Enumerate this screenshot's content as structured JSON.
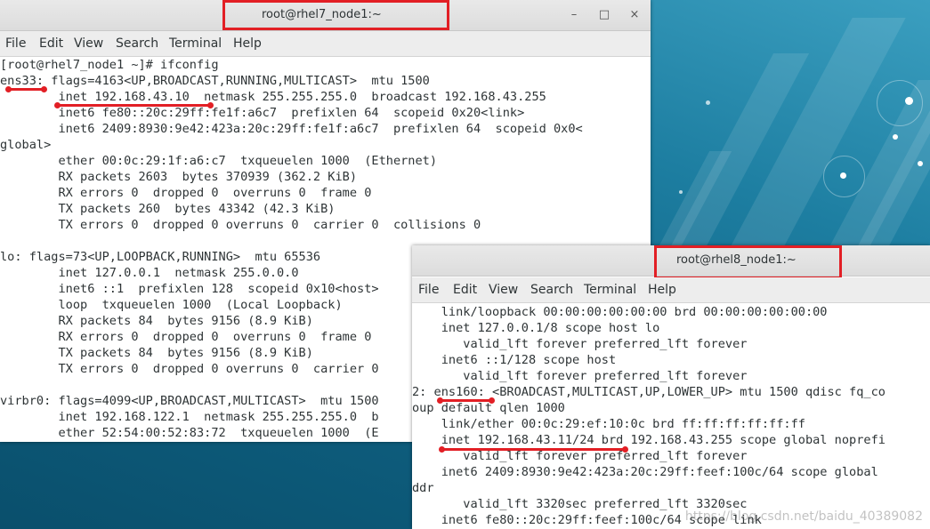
{
  "window1": {
    "title": "root@rhel7_node1:~",
    "menu": [
      "File",
      "Edit",
      "View",
      "Search",
      "Terminal",
      "Help"
    ],
    "controls": {
      "minimize": "–",
      "maximize": "□",
      "close": "×"
    },
    "lines": [
      "[root@rhel7_node1 ~]# ifconfig",
      "ens33: flags=4163<UP,BROADCAST,RUNNING,MULTICAST>  mtu 1500",
      "        inet 192.168.43.10  netmask 255.255.255.0  broadcast 192.168.43.255",
      "        inet6 fe80::20c:29ff:fe1f:a6c7  prefixlen 64  scopeid 0x20<link>",
      "        inet6 2409:8930:9e42:423a:20c:29ff:fe1f:a6c7  prefixlen 64  scopeid 0x0<",
      "global>",
      "        ether 00:0c:29:1f:a6:c7  txqueuelen 1000  (Ethernet)",
      "        RX packets 2603  bytes 370939 (362.2 KiB)",
      "        RX errors 0  dropped 0  overruns 0  frame 0",
      "        TX packets 260  bytes 43342 (42.3 KiB)",
      "        TX errors 0  dropped 0 overruns 0  carrier 0  collisions 0",
      "",
      "lo: flags=73<UP,LOOPBACK,RUNNING>  mtu 65536",
      "        inet 127.0.0.1  netmask 255.0.0.0",
      "        inet6 ::1  prefixlen 128  scopeid 0x10<host>",
      "        loop  txqueuelen 1000  (Local Loopback)",
      "        RX packets 84  bytes 9156 (8.9 KiB)",
      "        RX errors 0  dropped 0  overruns 0  frame 0",
      "        TX packets 84  bytes 9156 (8.9 KiB)",
      "        TX errors 0  dropped 0 overruns 0  carrier 0",
      "",
      "virbr0: flags=4099<UP,BROADCAST,MULTICAST>  mtu 1500",
      "        inet 192.168.122.1  netmask 255.255.255.0  b",
      "        ether 52:54:00:52:83:72  txqueuelen 1000  (E"
    ]
  },
  "window2": {
    "title": "root@rhel8_node1:~",
    "menu": [
      "File",
      "Edit",
      "View",
      "Search",
      "Terminal",
      "Help"
    ],
    "lines": [
      "    link/loopback 00:00:00:00:00:00 brd 00:00:00:00:00:00",
      "    inet 127.0.0.1/8 scope host lo",
      "       valid_lft forever preferred_lft forever",
      "    inet6 ::1/128 scope host",
      "       valid_lft forever preferred_lft forever",
      "2: ens160: <BROADCAST,MULTICAST,UP,LOWER_UP> mtu 1500 qdisc fq_co",
      "oup default qlen 1000",
      "    link/ether 00:0c:29:ef:10:0c brd ff:ff:ff:ff:ff:ff",
      "    inet 192.168.43.11/24 brd 192.168.43.255 scope global noprefi",
      "       valid_lft forever preferred_lft forever",
      "    inet6 2409:8930:9e42:423a:20c:29ff:feef:100c/64 scope global",
      "ddr",
      "       valid_lft 3320sec preferred_lft 3320sec",
      "    inet6 fe80::20c:29ff:feef:100c/64 scope link"
    ]
  },
  "watermark": "https://blog.csdn.net/baidu_40389082",
  "colors": {
    "highlight": "#e21f25",
    "terminal_text": "#2e3436",
    "terminal_bg": "#ffffff"
  }
}
